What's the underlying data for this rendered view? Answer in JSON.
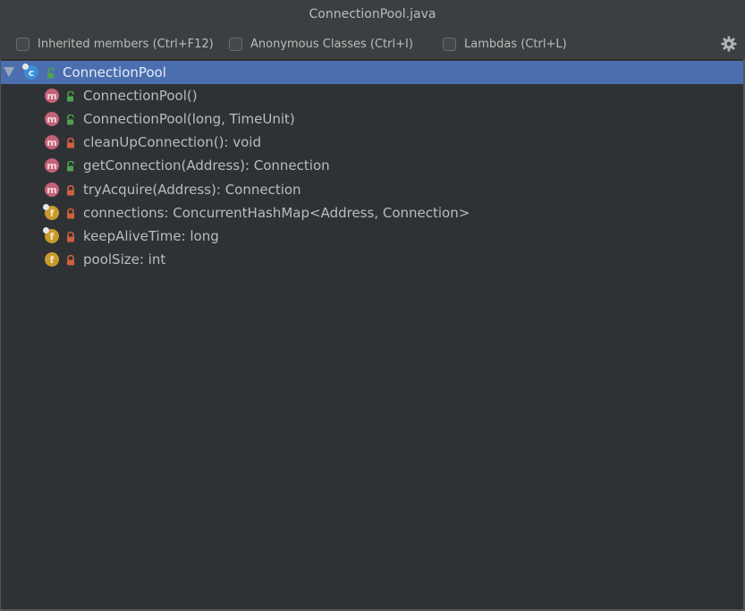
{
  "window": {
    "title": "ConnectionPool.java"
  },
  "options": {
    "inherited_label": "Inherited members (Ctrl+F12)",
    "anonymous_label": "Anonymous Classes (Ctrl+I)",
    "lambdas_label": "Lambdas (Ctrl+L)",
    "settings_icon": "gear-icon"
  },
  "tree": {
    "root": {
      "label": "ConnectionPool",
      "kind": "class",
      "visibility": "public",
      "expanded": true,
      "selected": true
    },
    "members": [
      {
        "label": "ConnectionPool()",
        "kind": "method",
        "visibility": "public"
      },
      {
        "label": "ConnectionPool(long, TimeUnit)",
        "kind": "method",
        "visibility": "public"
      },
      {
        "label": "cleanUpConnection(): void",
        "kind": "method",
        "visibility": "private"
      },
      {
        "label": "getConnection(Address): Connection",
        "kind": "method",
        "visibility": "public"
      },
      {
        "label": "tryAcquire(Address): Connection",
        "kind": "method",
        "visibility": "private"
      },
      {
        "label": "connections: ConcurrentHashMap<Address, Connection>",
        "kind": "field",
        "visibility": "private",
        "final": true
      },
      {
        "label": "keepAliveTime: long",
        "kind": "field",
        "visibility": "private",
        "final": true
      },
      {
        "label": "poolSize: int",
        "kind": "field",
        "visibility": "private",
        "final": false
      }
    ]
  },
  "colors": {
    "background": "#3c3f41",
    "tree_background": "#2f3235",
    "selection": "#4b6eaf",
    "method_badge": "#c46277",
    "field_badge": "#c89a2c",
    "class_badge": "#3d8fd6",
    "public_lock": "#4ea34e",
    "private_lock": "#d0613f"
  }
}
